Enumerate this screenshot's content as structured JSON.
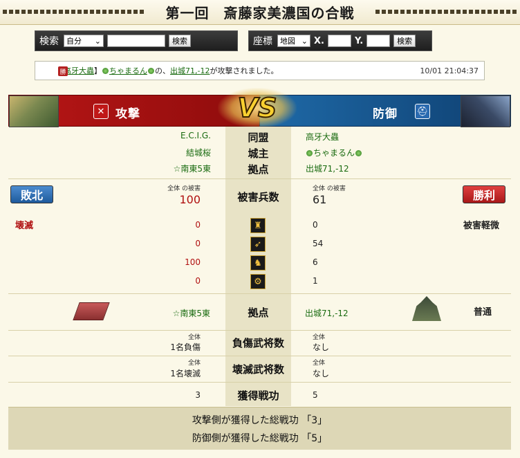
{
  "title": "第一回　斎藤家美濃国の合戦",
  "search": {
    "label": "検索",
    "select": "自分",
    "button": "検索"
  },
  "coord": {
    "label": "座標",
    "select": "地図",
    "x_label": "X.",
    "y_label": "Y.",
    "button": "検索"
  },
  "notice": {
    "badge": "勝",
    "prefix": "【",
    "alliance": "高牙大蟲",
    "suffix": "】",
    "lord": "ちゃまるん",
    "mid": "の、",
    "place": "出城71,-12",
    "tail": "が攻撃されました。",
    "time": "10/01 21:04:37"
  },
  "header": {
    "attack": "攻撃",
    "defense": "防御",
    "vs": "VS"
  },
  "labels": {
    "alliance": "同盟",
    "lord": "城主",
    "base": "拠点",
    "damage": "被害兵数",
    "base2": "拠点",
    "injured": "負傷武将数",
    "destroyed": "壊滅武将数",
    "merit": "獲得戦功"
  },
  "attacker": {
    "alliance": "E.C.I.G.",
    "lord": "結城桜",
    "base": "☆南東5東",
    "result": "敗北",
    "dmg_caption": "全体 の被害",
    "dmg": "100",
    "status": "壊滅",
    "units": [
      "0",
      "0",
      "100",
      "0"
    ],
    "base2": "☆南東5東",
    "injured_caption": "全体",
    "injured": "1名負傷",
    "destroyed_caption": "全体",
    "destroyed": "1名壊滅",
    "merit": "3"
  },
  "defender": {
    "alliance": "高牙大蟲",
    "lord": "ちゃまるん",
    "base": "出城71,-12",
    "result": "勝利",
    "dmg_caption": "全体 の被害",
    "dmg": "61",
    "status": "被害軽微",
    "units": [
      "0",
      "54",
      "6",
      "1"
    ],
    "base2": "出城71,-12",
    "castle_status": "普通",
    "injured_caption": "全体",
    "injured": "なし",
    "destroyed_caption": "全体",
    "destroyed": "なし",
    "merit": "5"
  },
  "footer": {
    "line1": "攻撃側が獲得した総戦功 「3」",
    "line2": "防御側が獲得した総戦功 「5」"
  }
}
